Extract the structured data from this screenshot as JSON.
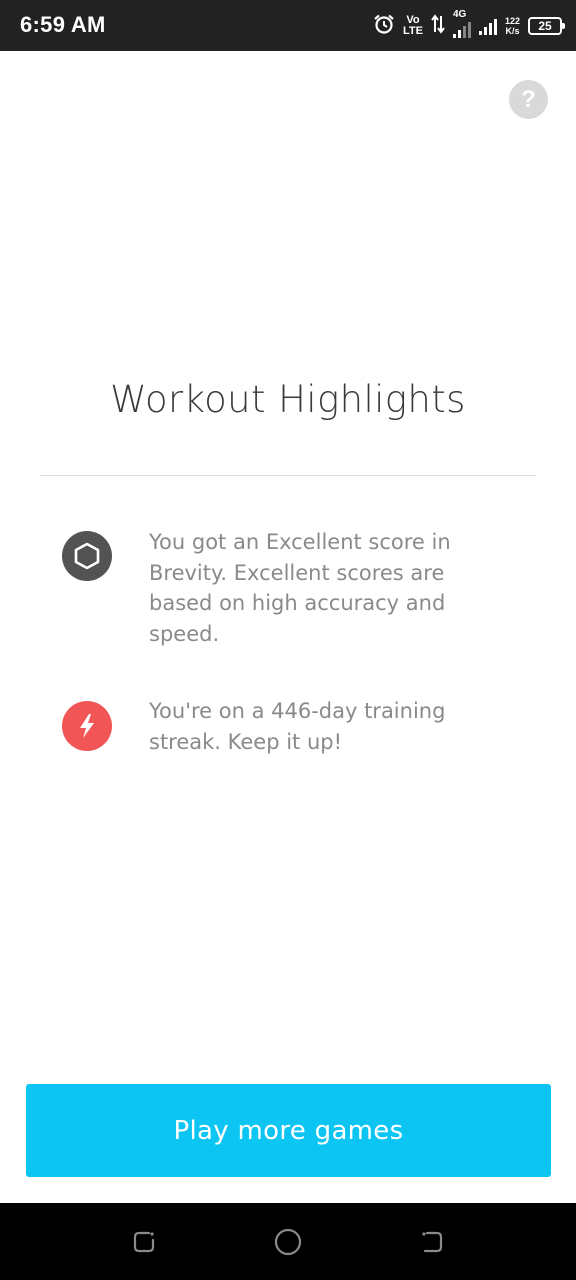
{
  "status_bar": {
    "time": "6:59 AM",
    "volte_top": "Vo",
    "volte_bottom": "LTE",
    "network": "4G",
    "speed_value": "122",
    "speed_unit": "K/s",
    "battery": "25",
    "icons": [
      "alarm-icon",
      "data-arrows-icon",
      "signal-icon",
      "signal-icon",
      "battery-icon"
    ]
  },
  "help": {
    "label": "?"
  },
  "title": "Workout Highlights",
  "highlights": [
    {
      "icon": "hexagon-icon",
      "color": "#535353",
      "text": "You got an Excellent score in Brevity. Excellent scores are based on high accuracy and speed."
    },
    {
      "icon": "lightning-icon",
      "color": "#f25555",
      "text": "You're on a 446-day training streak. Keep it up!"
    }
  ],
  "play_button": {
    "label": "Play more games",
    "color": "#0cc5f2"
  },
  "nav_bar": {
    "icons": [
      "recents-icon",
      "home-icon",
      "back-icon"
    ]
  }
}
